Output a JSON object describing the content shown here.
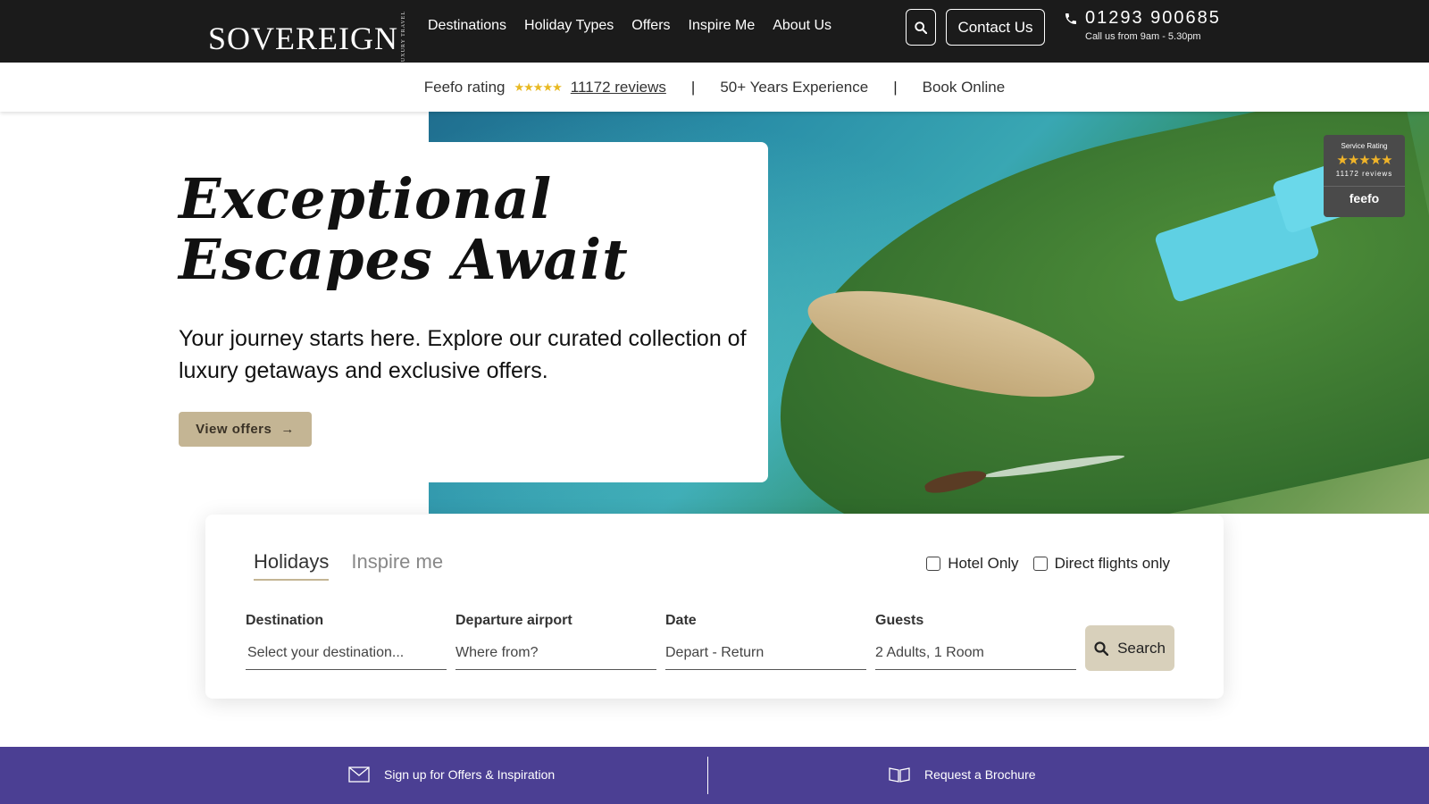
{
  "header": {
    "logo": "SOVEREIGN",
    "logo_sub": "LUXURY TRAVEL",
    "nav": [
      "Destinations",
      "Holiday Types",
      "Offers",
      "Inspire Me",
      "About Us"
    ],
    "search_icon": "search-icon",
    "contact_label": "Contact Us",
    "phone_number": "01293 900685",
    "phone_hours": "Call us from 9am - 5.30pm"
  },
  "trust_bar": {
    "feefo_label": "Feefo rating",
    "stars": "★★★★★",
    "reviews": "11172 reviews",
    "separator": "|",
    "experience": "50+ Years Experience",
    "book": "Book Online"
  },
  "feefo_badge": {
    "title": "Service Rating",
    "stars": "★★★★★",
    "reviews": "11172 reviews",
    "brand": "feefo"
  },
  "hero": {
    "title": "Exceptional Escapes Await",
    "subtitle": "Your journey starts here. Explore our curated collection of luxury getaways and exclusive offers.",
    "cta": "View offers",
    "cta_icon": "→"
  },
  "search": {
    "tabs": [
      "Holidays",
      "Inspire me"
    ],
    "active_tab": "Holidays",
    "checks": [
      "Hotel Only",
      "Direct flights only"
    ],
    "fields": [
      {
        "label": "Destination",
        "value": "Select your destination..."
      },
      {
        "label": "Departure airport",
        "value": "Where from?"
      },
      {
        "label": "Date",
        "value": "Depart - Return"
      },
      {
        "label": "Guests",
        "value": "2 Adults, 1 Room"
      }
    ],
    "submit": "Search"
  },
  "bottom_bar": {
    "signup": "Sign up for Offers & Inspiration",
    "brochure": "Request a Brochure"
  },
  "colors": {
    "header_bg": "#1b1b1b",
    "accent_gold": "#c4b594",
    "bottom_bar": "#4b3f93",
    "star": "#e8b923"
  }
}
